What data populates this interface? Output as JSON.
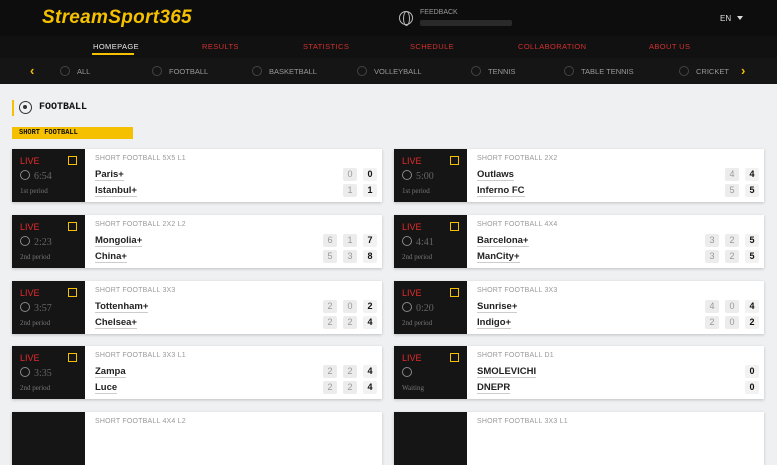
{
  "header": {
    "logo": "StreamSport365",
    "feedback_label": "FEEDBACK",
    "lang": "EN"
  },
  "main_nav": [
    {
      "label": "HOMEPAGE",
      "active": true
    },
    {
      "label": "RESULTS"
    },
    {
      "label": "STATISTICS"
    },
    {
      "label": "SCHEDULE"
    },
    {
      "label": "COLLABORATION"
    },
    {
      "label": "ABOUT US"
    }
  ],
  "sport_nav": {
    "prev": "‹",
    "next": "›",
    "items": [
      "ALL",
      "FOOTBALL",
      "BASKETBALL",
      "VOLLEYBALL",
      "TENNIS",
      "TABLE TENNIS",
      "CRICKET"
    ]
  },
  "section": {
    "title": "FOOTBALL",
    "subtitle": "SHORT FOOTBALL"
  },
  "matches": [
    {
      "status": "LIVE",
      "time": "6:54",
      "period": "1st period",
      "league": "SHORT FOOTBALL 5X5 L1",
      "home": "Paris+",
      "away": "Istanbul+",
      "home_scores": [
        "0",
        "0"
      ],
      "away_scores": [
        "1",
        "1"
      ]
    },
    {
      "status": "LIVE",
      "time": "5:00",
      "period": "1st period",
      "league": "SHORT FOOTBALL 2X2",
      "home": "Outlaws",
      "away": "Inferno FC",
      "home_scores": [
        "4",
        "4"
      ],
      "away_scores": [
        "5",
        "5"
      ]
    },
    {
      "status": "LIVE",
      "time": "2:23",
      "period": "2nd period",
      "league": "SHORT FOOTBALL 2X2 L2",
      "home": "Mongolia+",
      "away": "China+",
      "home_scores": [
        "6",
        "1",
        "7"
      ],
      "away_scores": [
        "5",
        "3",
        "8"
      ]
    },
    {
      "status": "LIVE",
      "time": "4:41",
      "period": "2nd period",
      "league": "SHORT FOOTBALL 4X4",
      "home": "Barcelona+",
      "away": "ManCity+",
      "home_scores": [
        "3",
        "2",
        "5"
      ],
      "away_scores": [
        "3",
        "2",
        "5"
      ]
    },
    {
      "status": "LIVE",
      "time": "3:57",
      "period": "2nd period",
      "league": "SHORT FOOTBALL 3X3",
      "home": "Tottenham+",
      "away": "Chelsea+",
      "home_scores": [
        "2",
        "0",
        "2"
      ],
      "away_scores": [
        "2",
        "2",
        "4"
      ]
    },
    {
      "status": "LIVE",
      "time": "0:20",
      "period": "2nd period",
      "league": "SHORT FOOTBALL 3X3",
      "home": "Sunrise+",
      "away": "Indigo+",
      "home_scores": [
        "4",
        "0",
        "4"
      ],
      "away_scores": [
        "2",
        "0",
        "2"
      ]
    },
    {
      "status": "LIVE",
      "time": "3:35",
      "period": "2nd period",
      "league": "SHORT FOOTBALL 3X3 L1",
      "home": "Zampa",
      "away": "Luce",
      "home_scores": [
        "2",
        "2",
        "4"
      ],
      "away_scores": [
        "2",
        "2",
        "4"
      ]
    },
    {
      "status": "LIVE",
      "time": "",
      "period": "Waiting",
      "league": "SHORT FOOTBALL D1",
      "home": "SMOLEVICHI",
      "away": "DNEPR",
      "home_scores": [
        "0"
      ],
      "away_scores": [
        "0"
      ]
    },
    {
      "status": "",
      "time": "",
      "period": "",
      "league": "SHORT FOOTBALL 4X4 L2",
      "home": "",
      "away": "",
      "home_scores": [],
      "away_scores": []
    },
    {
      "status": "",
      "time": "",
      "period": "",
      "league": "SHORT FOOTBALL 3X3 L1",
      "home": "",
      "away": "",
      "home_scores": [],
      "away_scores": []
    }
  ]
}
